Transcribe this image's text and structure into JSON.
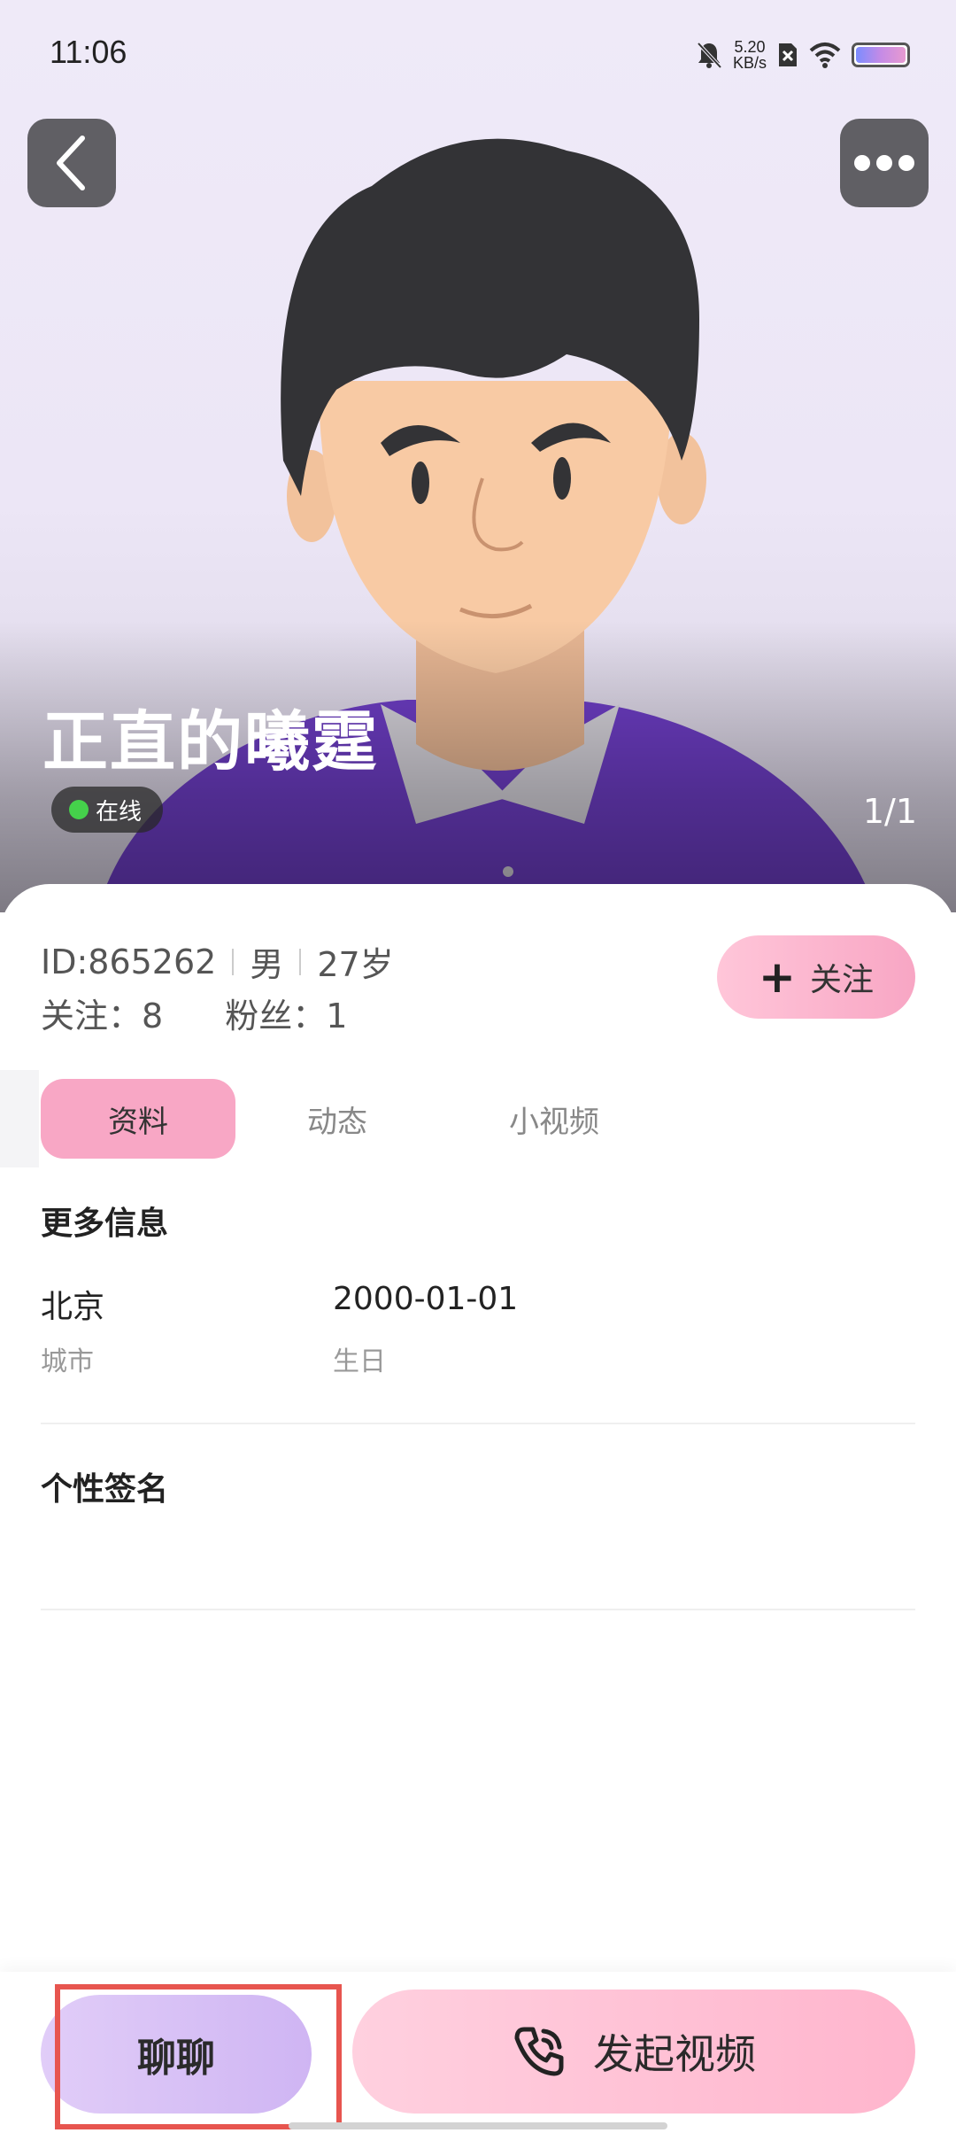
{
  "status_bar": {
    "time": "11:06",
    "net_speed_value": "5.20",
    "net_speed_unit": "KB/s",
    "icons": [
      "bell-off-icon",
      "sim-off-icon",
      "wifi-icon",
      "battery-icon"
    ]
  },
  "profile": {
    "name": "正直的曦霆",
    "online_status": "在线",
    "photo_counter": "1/1",
    "id_text": "ID:865262",
    "gender": "男",
    "age": "27岁",
    "following": "关注：8",
    "fans": "粉丝：1"
  },
  "follow_button": {
    "label": "关注"
  },
  "tabs": [
    {
      "label": "资料",
      "active": true
    },
    {
      "label": "动态",
      "active": false
    },
    {
      "label": "小视频",
      "active": false
    }
  ],
  "more_info": {
    "title": "更多信息",
    "city_value": "北京",
    "city_label": "城市",
    "birthday_value": "2000-01-01",
    "birthday_label": "生日"
  },
  "signature": {
    "title": "个性签名"
  },
  "actions": {
    "chat_label": "聊聊",
    "video_label": "发起视频"
  },
  "colors": {
    "accent_pink": "#f8a7c5",
    "accent_purple": "#d6c0f6",
    "online_green": "#45d14b",
    "highlight_red": "#e7554f"
  }
}
